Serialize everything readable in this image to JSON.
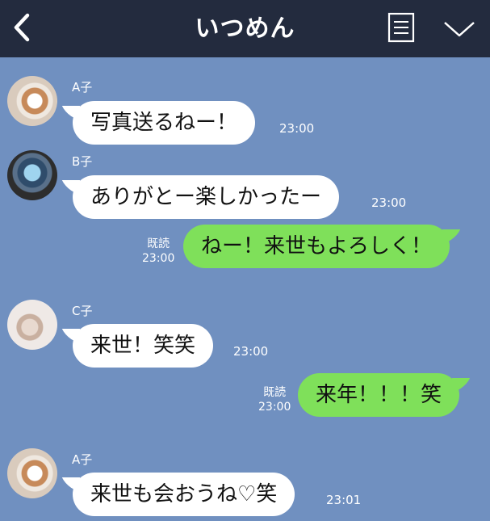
{
  "header": {
    "title": "いつめん",
    "back_icon": "chevron-left-icon",
    "menu_icon": "list-icon",
    "expand_icon": "chevron-down-icon"
  },
  "colors": {
    "header_bg": "#232b3e",
    "chat_bg": "#7090c0",
    "incoming_bubble": "#ffffff",
    "outgoing_bubble": "#7fe05a"
  },
  "messages": [
    {
      "direction": "incoming",
      "sender": "A子",
      "text": "写真送るねー！",
      "time": "23:00"
    },
    {
      "direction": "incoming",
      "sender": "B子",
      "text": "ありがとー楽しかったー",
      "time": "23:00"
    },
    {
      "direction": "outgoing",
      "read": "既読",
      "text": "ねー！来世もよろしく！",
      "time": "23:00"
    },
    {
      "direction": "incoming",
      "sender": "C子",
      "text": "来世！笑笑",
      "time": "23:00"
    },
    {
      "direction": "outgoing",
      "read": "既読",
      "text": "来年！！！笑",
      "time": "23:00"
    },
    {
      "direction": "incoming",
      "sender": "A子",
      "text": "来世も会おうね♡笑",
      "time": "23:01"
    }
  ]
}
